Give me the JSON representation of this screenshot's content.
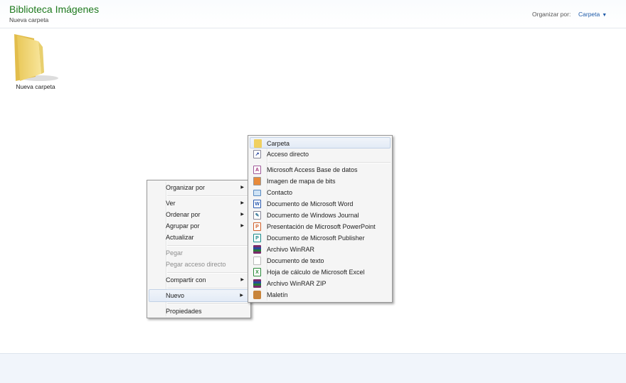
{
  "header": {
    "title": "Biblioteca Imágenes",
    "subtitle": "Nueva carpeta",
    "organize_label": "Organizar por:",
    "organize_value": "Carpeta"
  },
  "files": [
    {
      "name": "Nueva carpeta"
    }
  ],
  "context_menu": {
    "items": [
      {
        "label": "Organizar por",
        "submenu": true
      },
      {
        "label": "Ver",
        "submenu": true
      },
      {
        "label": "Ordenar por",
        "submenu": true
      },
      {
        "label": "Agrupar por",
        "submenu": true
      },
      {
        "label": "Actualizar"
      },
      {
        "label": "Pegar",
        "disabled": true
      },
      {
        "label": "Pegar acceso directo",
        "disabled": true
      },
      {
        "label": "Compartir con",
        "submenu": true
      },
      {
        "label": "Nuevo",
        "submenu": true,
        "highlighted": true
      },
      {
        "label": "Propiedades"
      }
    ]
  },
  "new_submenu": {
    "items": [
      {
        "label": "Carpeta",
        "icon": "folder-icon"
      },
      {
        "label": "Acceso directo",
        "icon": "shortcut-icon"
      },
      {
        "label": "Microsoft Access Base de datos",
        "icon": "access-icon"
      },
      {
        "label": "Imagen de mapa de bits",
        "icon": "bitmap-icon"
      },
      {
        "label": "Contacto",
        "icon": "contact-icon"
      },
      {
        "label": "Documento de Microsoft Word",
        "icon": "word-icon"
      },
      {
        "label": "Documento de Windows Journal",
        "icon": "journal-icon"
      },
      {
        "label": "Presentación de Microsoft PowerPoint",
        "icon": "powerpoint-icon"
      },
      {
        "label": "Documento de Microsoft Publisher",
        "icon": "publisher-icon"
      },
      {
        "label": "Archivo WinRAR",
        "icon": "winrar-icon"
      },
      {
        "label": "Documento de texto",
        "icon": "text-icon"
      },
      {
        "label": "Hoja de cálculo de Microsoft Excel",
        "icon": "excel-icon"
      },
      {
        "label": "Archivo WinRAR ZIP",
        "icon": "winrar-zip-icon"
      },
      {
        "label": "Maletín",
        "icon": "briefcase-icon"
      }
    ]
  }
}
